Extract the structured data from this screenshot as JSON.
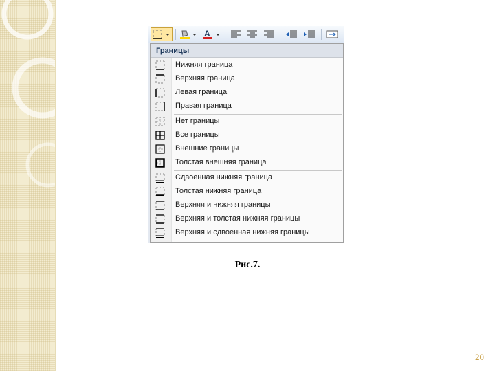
{
  "menu": {
    "header": "Границы",
    "items": [
      {
        "label": "Нижняя граница",
        "icon": "bottom-border-icon"
      },
      {
        "label": "Верхняя граница",
        "icon": "top-border-icon"
      },
      {
        "label": "Левая граница",
        "icon": "left-border-icon"
      },
      {
        "label": "Правая граница",
        "icon": "right-border-icon"
      },
      {
        "label": "Нет границы",
        "icon": "no-border-icon"
      },
      {
        "label": "Все границы",
        "icon": "all-borders-icon"
      },
      {
        "label": "Внешние границы",
        "icon": "outside-borders-icon"
      },
      {
        "label": "Толстая внешняя граница",
        "icon": "thick-box-border-icon"
      },
      {
        "label": "Сдвоенная нижняя граница",
        "icon": "double-bottom-border-icon"
      },
      {
        "label": "Толстая нижняя граница",
        "icon": "thick-bottom-border-icon"
      },
      {
        "label": "Верхняя и нижняя границы",
        "icon": "top-bottom-border-icon"
      },
      {
        "label": "Верхняя и толстая нижняя границы",
        "icon": "top-thick-bottom-border-icon"
      },
      {
        "label": "Верхняя и сдвоенная нижняя границы",
        "icon": "top-double-bottom-border-icon"
      }
    ]
  },
  "toolbar": {
    "buttons": [
      "borders-icon",
      "fill-color-icon",
      "font-color-icon",
      "align-left-icon",
      "align-center-icon",
      "align-right-icon",
      "decrease-indent-icon",
      "increase-indent-icon",
      "merge-cells-icon"
    ]
  },
  "caption": "Рис.7.",
  "page_number": "20",
  "colors": {
    "accent": "#c9a24a",
    "menu_header": "#1e395b",
    "font_color_red": "#d42020",
    "fill_yellow": "#ffd700"
  }
}
